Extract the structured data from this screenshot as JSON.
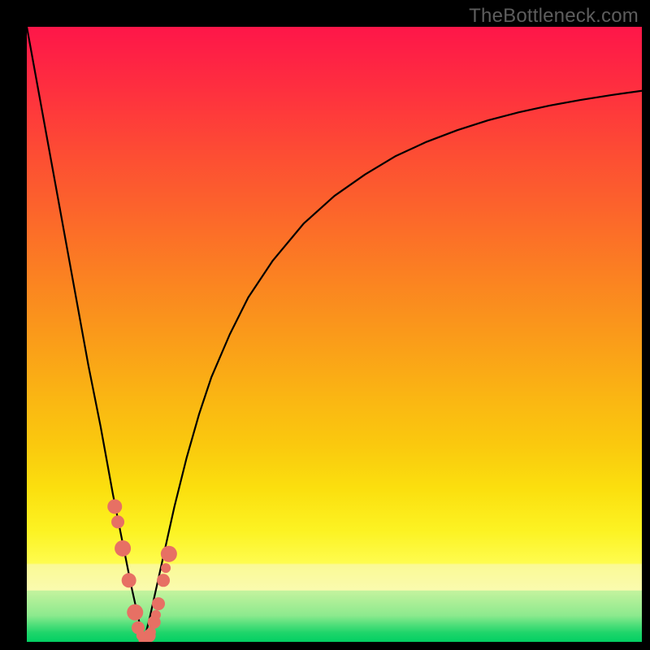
{
  "watermark": {
    "text": "TheBottleneck.com"
  },
  "colors": {
    "black": "#000000",
    "curve": "#000000",
    "marker": "#e77064",
    "gradient_stops": [
      {
        "y": 0.0,
        "color": "#fe1649"
      },
      {
        "y": 0.1,
        "color": "#fe2f3f"
      },
      {
        "y": 0.2,
        "color": "#fd4b34"
      },
      {
        "y": 0.3,
        "color": "#fc652b"
      },
      {
        "y": 0.4,
        "color": "#fb8022"
      },
      {
        "y": 0.5,
        "color": "#fa9a1a"
      },
      {
        "y": 0.6,
        "color": "#fab513"
      },
      {
        "y": 0.68,
        "color": "#fac90e"
      },
      {
        "y": 0.75,
        "color": "#fbdf0e"
      },
      {
        "y": 0.82,
        "color": "#fcf323"
      },
      {
        "y": 0.872,
        "color": "#fefc4f"
      },
      {
        "y": 0.874,
        "color": "#faf995"
      },
      {
        "y": 0.915,
        "color": "#fafbae"
      },
      {
        "y": 0.917,
        "color": "#c4f39e"
      },
      {
        "y": 0.958,
        "color": "#8ae98d"
      },
      {
        "y": 0.972,
        "color": "#4fdf7a"
      },
      {
        "y": 0.985,
        "color": "#1ed56a"
      },
      {
        "y": 1.0,
        "color": "#00cf62"
      }
    ]
  },
  "chart_data": {
    "type": "line",
    "title": "",
    "xlabel": "",
    "ylabel": "",
    "xlim": [
      0,
      100
    ],
    "ylim": [
      0,
      100
    ],
    "note": "V-shaped bottleneck percentage curve; minimum near x≈19. y-axis is percent bottleneck (0 at bottom, 100 at top). Background gradient maps y: green≈0% (ideal) up to red≈100% (severe).",
    "series": [
      {
        "name": "bottleneck-curve",
        "x": [
          0,
          2,
          4,
          6,
          8,
          10,
          12,
          14,
          15,
          16,
          17,
          18,
          18.5,
          19,
          19.5,
          20,
          21,
          22,
          23,
          24,
          26,
          28,
          30,
          33,
          36,
          40,
          45,
          50,
          55,
          60,
          65,
          70,
          75,
          80,
          85,
          90,
          95,
          100
        ],
        "y": [
          100,
          89,
          78,
          67,
          56,
          45,
          35,
          24,
          19,
          14,
          9,
          4.5,
          2.3,
          0.5,
          2.0,
          4.0,
          8.5,
          13,
          17.5,
          22,
          30,
          37,
          43,
          50,
          56,
          62,
          68,
          72.5,
          76,
          79,
          81.3,
          83.2,
          84.8,
          86.1,
          87.2,
          88.1,
          88.9,
          89.6
        ]
      }
    ],
    "markers": {
      "name": "highlighted-points",
      "color": "#e77064",
      "x": [
        14.3,
        14.8,
        15.6,
        16.6,
        17.6,
        18.1,
        18.6,
        19.2,
        19.9,
        20.2,
        20.7,
        21.0,
        21.4,
        22.2,
        22.6,
        23.1
      ],
      "y": [
        22.0,
        19.5,
        15.2,
        10.0,
        4.8,
        2.3,
        1.0,
        0.4,
        1.0,
        1.6,
        3.2,
        4.4,
        6.2,
        10.0,
        12.0,
        14.3
      ],
      "r": [
        9,
        8,
        10,
        9,
        10,
        8,
        6,
        8,
        8,
        6,
        8,
        6,
        8,
        8,
        6,
        10
      ]
    }
  }
}
